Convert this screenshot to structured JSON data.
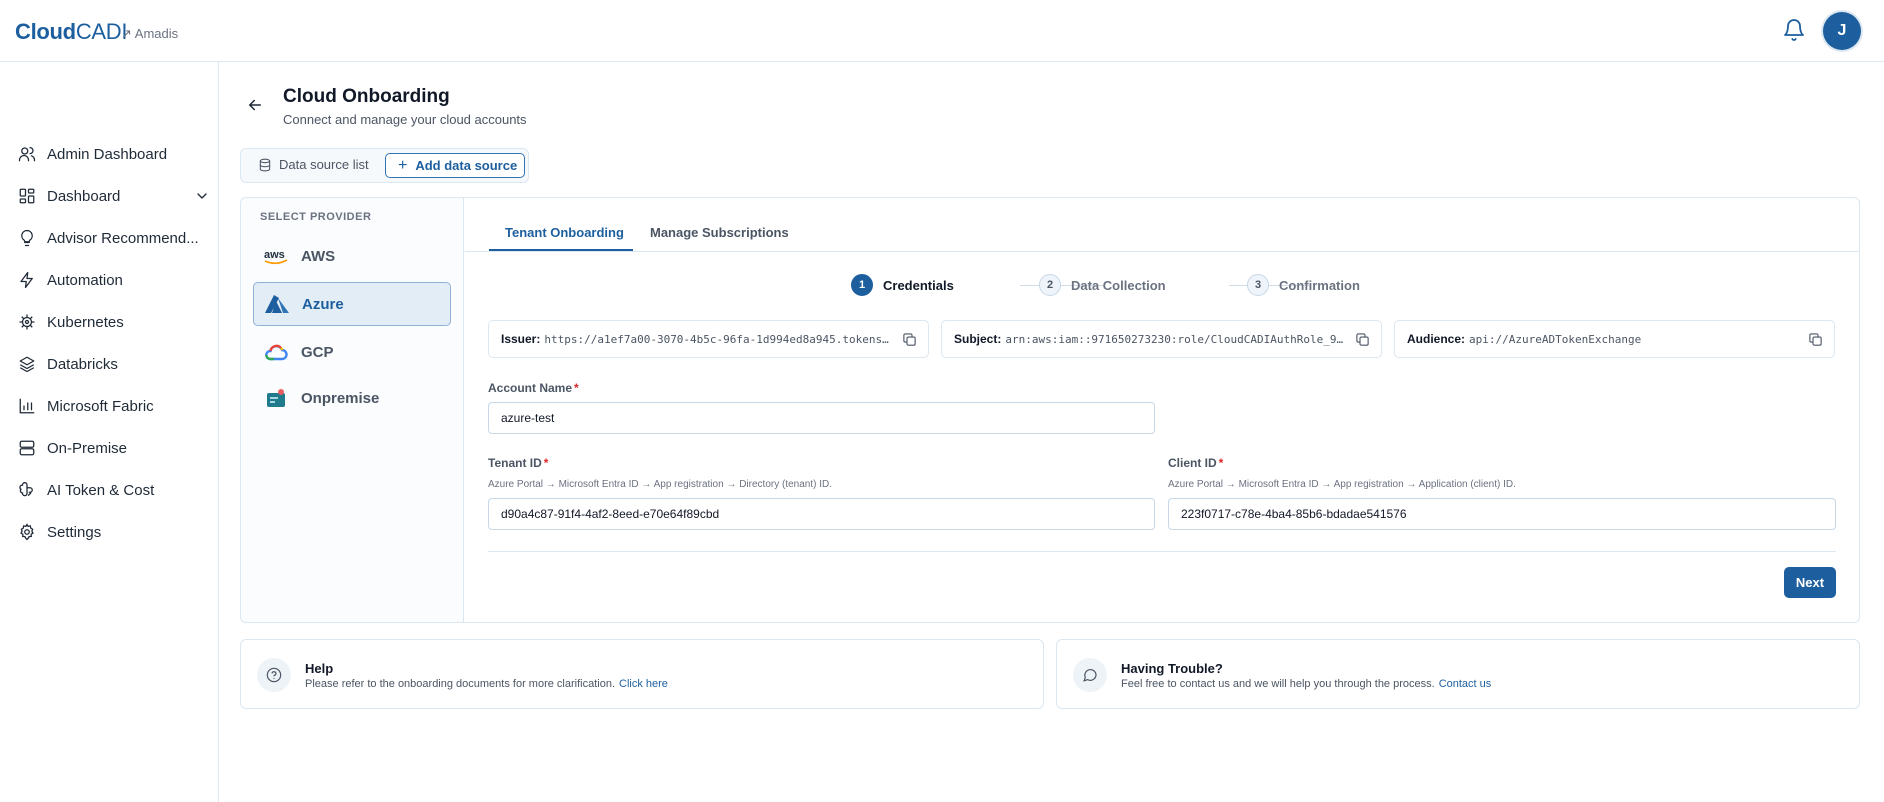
{
  "brand": {
    "part1": "Cloud",
    "part2": "CADI",
    "org": "↗ Amadis"
  },
  "user": {
    "initial": "J"
  },
  "sidebar": {
    "items": [
      {
        "label": "Admin Dashboard",
        "icon": "users-icon"
      },
      {
        "label": "Dashboard",
        "icon": "grid-icon",
        "expandable": true
      },
      {
        "label": "Advisor Recommend...",
        "icon": "lightbulb-icon"
      },
      {
        "label": "Automation",
        "icon": "bolt-icon"
      },
      {
        "label": "Kubernetes",
        "icon": "helm-icon"
      },
      {
        "label": "Databricks",
        "icon": "layers-icon"
      },
      {
        "label": "Microsoft Fabric",
        "icon": "bar-chart-icon"
      },
      {
        "label": "On-Premise",
        "icon": "server-icon"
      },
      {
        "label": "AI Token & Cost",
        "icon": "brain-icon"
      },
      {
        "label": "Settings",
        "icon": "gear-icon"
      }
    ]
  },
  "header": {
    "title": "Cloud Onboarding",
    "subtitle": "Connect and manage your cloud accounts"
  },
  "source_tabs": {
    "list_label": "Data source list",
    "add_label": "Add data source"
  },
  "providers": {
    "title": "SELECT PROVIDER",
    "items": [
      {
        "label": "AWS",
        "active": false
      },
      {
        "label": "Azure",
        "active": true
      },
      {
        "label": "GCP",
        "active": false
      },
      {
        "label": "Onpremise",
        "active": false
      }
    ]
  },
  "tabs": [
    {
      "label": "Tenant Onboarding",
      "active": true
    },
    {
      "label": "Manage Subscriptions",
      "active": false
    }
  ],
  "steps": [
    {
      "num": "1",
      "label": "Credentials",
      "active": true
    },
    {
      "num": "2",
      "label": "Data Collection",
      "active": false
    },
    {
      "num": "3",
      "label": "Confirmation",
      "active": false
    }
  ],
  "info": {
    "issuer": {
      "key": "Issuer:",
      "value": "https://a1ef7a00-3070-4b5c-96fa-1d994ed8a945.tokens…"
    },
    "subject": {
      "key": "Subject:",
      "value": "arn:aws:iam::971650273230:role/CloudCADIAuthRole_9…"
    },
    "audience": {
      "key": "Audience:",
      "value": "api://AzureADTokenExchange"
    }
  },
  "form": {
    "account_name": {
      "label": "Account Name",
      "value": "azure-test"
    },
    "tenant_id": {
      "label": "Tenant ID",
      "hint": "Azure Portal → Microsoft Entra ID → App registration → Directory (tenant) ID.",
      "value": "d90a4c87-91f4-4af2-8eed-e70e64f89cbd"
    },
    "client_id": {
      "label": "Client ID",
      "hint": "Azure Portal → Microsoft Entra ID → App registration → Application (client) ID.",
      "value": "223f0717-c78e-4ba4-85b6-bdadae541576"
    },
    "required_mark": "*",
    "next_label": "Next"
  },
  "help": {
    "title": "Help",
    "text": "Please refer to the onboarding documents for more clarification.",
    "link": "Click here"
  },
  "trouble": {
    "title": "Having Trouble?",
    "text": "Feel free to contact us and we will help you through the process.",
    "link": "Contact us"
  },
  "colors": {
    "brand": "#1d5f9e",
    "border": "#dbe7f1",
    "required": "#dc2626"
  }
}
